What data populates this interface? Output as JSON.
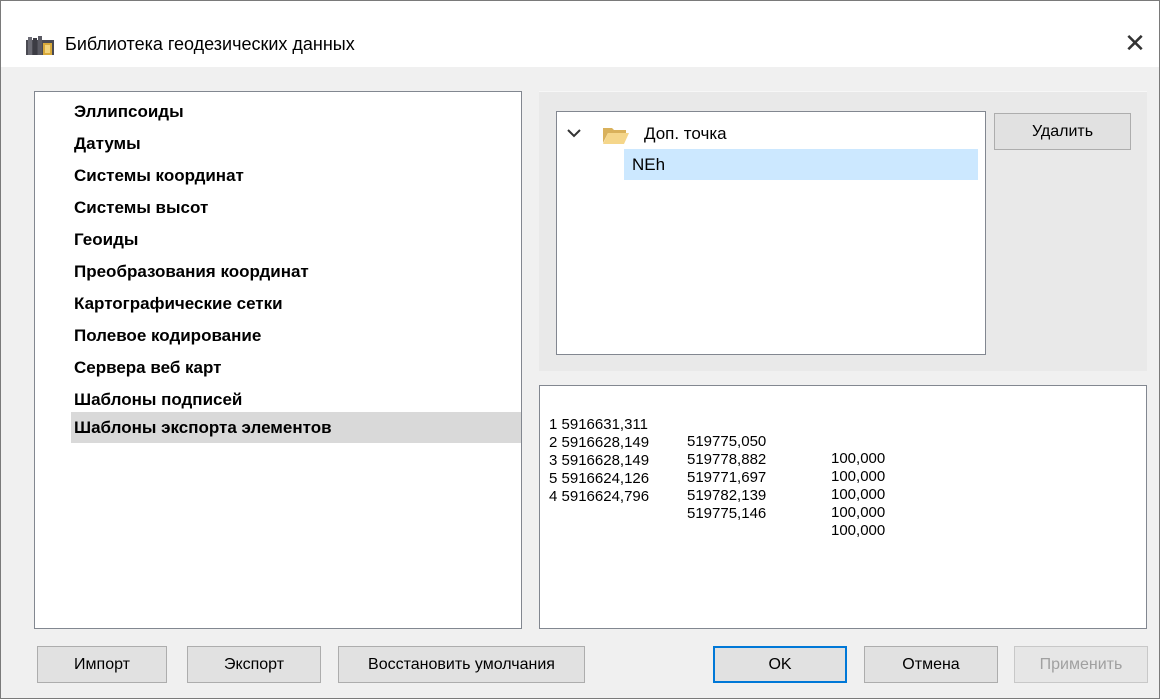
{
  "window": {
    "title": "Библиотека геодезических данных",
    "icon": "library-books-icon",
    "close_glyph": "✕"
  },
  "categories": [
    "Эллипсоиды",
    "Датумы",
    "Системы координат",
    "Системы высот",
    "Геоиды",
    "Преобразования координат",
    "Картографические сетки",
    "Полевое кодирование",
    "Сервера веб карт",
    "Шаблоны подписей",
    "Шаблоны экспорта элементов"
  ],
  "selected_category": "Шаблоны экспорта элементов",
  "tree": {
    "root_label": "Доп. точка",
    "child_label": "NEh"
  },
  "delete_button": "Удалить",
  "points": [
    {
      "id_n": "1 5916631,311",
      "e": "519775,050",
      "h": "100,000"
    },
    {
      "id_n": "2 5916628,149",
      "e": "519778,882",
      "h": "100,000"
    },
    {
      "id_n": "3 5916628,149",
      "e": "519771,697",
      "h": "100,000"
    },
    {
      "id_n": "5 5916624,126",
      "e": "519782,139",
      "h": "100,000"
    },
    {
      "id_n": "4 5916624,796",
      "e": "519775,146",
      "h": "100,000"
    }
  ],
  "buttons": {
    "import": "Импорт",
    "export": "Экспорт",
    "restore": "Восстановить умолчания",
    "ok": "OK",
    "cancel": "Отмена",
    "apply": "Применить"
  },
  "colors": {
    "selection_tree": "#cce8ff",
    "selection_list": "#d9d9d9",
    "default_button_border": "#0078d7"
  }
}
